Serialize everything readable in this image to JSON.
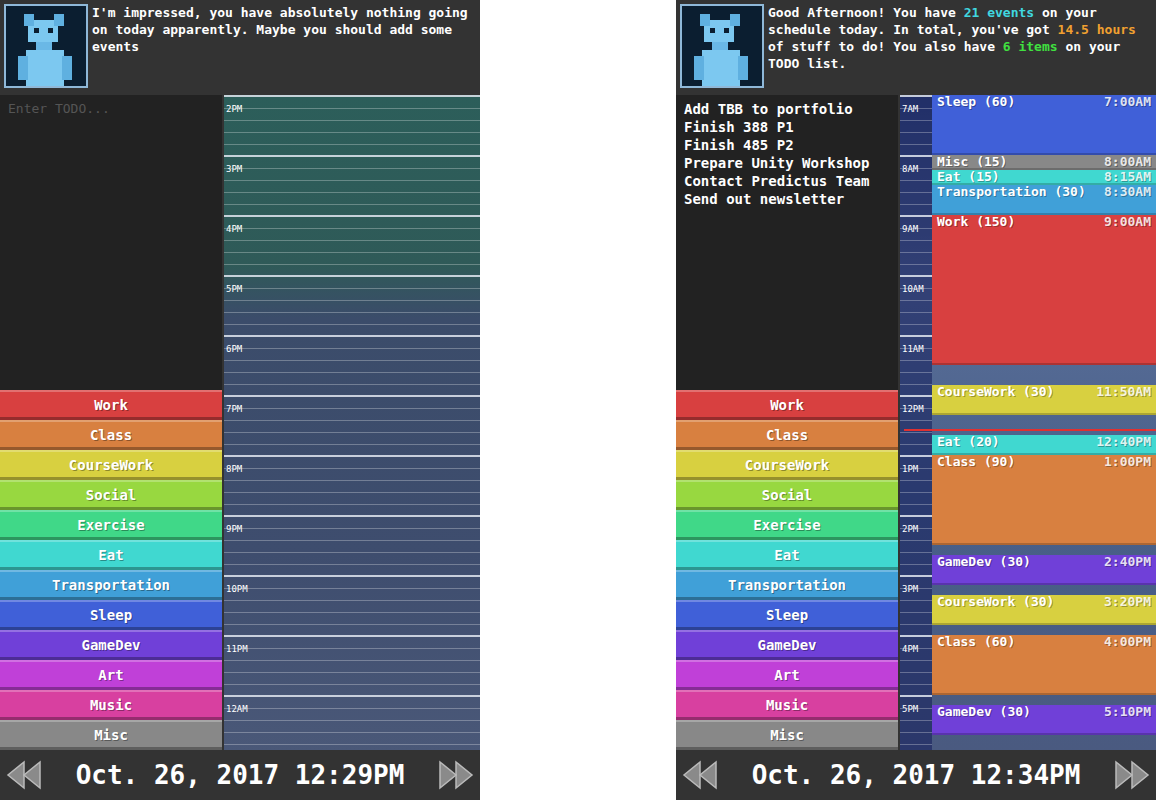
{
  "screens": [
    {
      "header": {
        "message": [
          {
            "text": "I'm impressed, you have absolutely nothing going on today apparently. Maybe you should add some events",
            "color": "#ffffff"
          }
        ]
      },
      "todo": {
        "placeholder": "Enter TODO...",
        "items": []
      },
      "categories": [
        {
          "label": "Work",
          "color": "#d84040"
        },
        {
          "label": "Class",
          "color": "#d88040"
        },
        {
          "label": "CourseWork",
          "color": "#d8d040"
        },
        {
          "label": "Social",
          "color": "#98d840"
        },
        {
          "label": "Exercise",
          "color": "#40d888"
        },
        {
          "label": "Eat",
          "color": "#40d8d0"
        },
        {
          "label": "Transportation",
          "color": "#40a0d8"
        },
        {
          "label": "Sleep",
          "color": "#4060d8"
        },
        {
          "label": "GameDev",
          "color": "#7040d8"
        },
        {
          "label": "Art",
          "color": "#c040d8"
        },
        {
          "label": "Music",
          "color": "#d840a0"
        },
        {
          "label": "Misc",
          "color": "#888888"
        }
      ],
      "calendar": {
        "hours": [
          "2PM",
          "3PM",
          "4PM",
          "5PM",
          "6PM",
          "7PM",
          "8PM",
          "9PM",
          "10PM",
          "11PM",
          "12AM"
        ],
        "events": []
      },
      "footer": {
        "date": "Oct. 26, 2017 12:29PM"
      }
    },
    {
      "header": {
        "message": [
          {
            "text": "Good Afternoon! You have ",
            "color": "#ffffff"
          },
          {
            "text": "21 events",
            "color": "#40d8e0"
          },
          {
            "text": " on your schedule today. In total, you've got ",
            "color": "#ffffff"
          },
          {
            "text": "14.5 hours",
            "color": "#f0a030"
          },
          {
            "text": " of stuff to do! You also have ",
            "color": "#ffffff"
          },
          {
            "text": "6 items",
            "color": "#40e040"
          },
          {
            "text": " on your TODO list.",
            "color": "#ffffff"
          }
        ]
      },
      "todo": {
        "placeholder": "",
        "items": [
          "Add TBB to portfolio",
          "Finish 388 P1",
          "Finish 485 P2",
          "Prepare Unity Workshop",
          "Contact Predictus Team",
          "Send out newsletter"
        ]
      },
      "categories": [
        {
          "label": "Work",
          "color": "#d84040"
        },
        {
          "label": "Class",
          "color": "#d88040"
        },
        {
          "label": "CourseWork",
          "color": "#d8d040"
        },
        {
          "label": "Social",
          "color": "#98d840"
        },
        {
          "label": "Exercise",
          "color": "#40d888"
        },
        {
          "label": "Eat",
          "color": "#40d8d0"
        },
        {
          "label": "Transportation",
          "color": "#40a0d8"
        },
        {
          "label": "Sleep",
          "color": "#4060d8"
        },
        {
          "label": "GameDev",
          "color": "#7040d8"
        },
        {
          "label": "Art",
          "color": "#c040d8"
        },
        {
          "label": "Music",
          "color": "#d840a0"
        },
        {
          "label": "Misc",
          "color": "#888888"
        }
      ],
      "calendar": {
        "hours": [
          "7AM",
          "8AM",
          "9AM",
          "10AM",
          "11AM",
          "12PM",
          "1PM",
          "2PM",
          "3PM",
          "4PM",
          "5PM"
        ],
        "events": [
          {
            "label": "Sleep (60)",
            "start": "7:00AM",
            "color": "#4060d8"
          },
          {
            "label": "Misc (15)",
            "start": "8:00AM",
            "color": "#888888"
          },
          {
            "label": "Eat (15)",
            "start": "8:15AM",
            "color": "#40d8d0"
          },
          {
            "label": "Transportation (30)",
            "start": "8:30AM",
            "color": "#40a0d8"
          },
          {
            "label": "Work (150)",
            "start": "9:00AM",
            "color": "#d84040"
          },
          {
            "label": "CourseWork (30)",
            "start": "11:50AM",
            "color": "#d8d040"
          },
          {
            "label": "Eat (20)",
            "start": "12:40PM",
            "color": "#40d8d0"
          },
          {
            "label": "Class (90)",
            "start": "1:00PM",
            "color": "#d88040"
          },
          {
            "label": "GameDev (30)",
            "start": "2:40PM",
            "color": "#7040d8"
          },
          {
            "label": "CourseWork (30)",
            "start": "3:20PM",
            "color": "#d8d040"
          },
          {
            "label": "Class (60)",
            "start": "4:00PM",
            "color": "#d88040"
          },
          {
            "label": "GameDev (30)",
            "start": "5:10PM",
            "color": "#7040d8"
          }
        ]
      },
      "footer": {
        "date": "Oct. 26, 2017 12:34PM"
      }
    }
  ]
}
